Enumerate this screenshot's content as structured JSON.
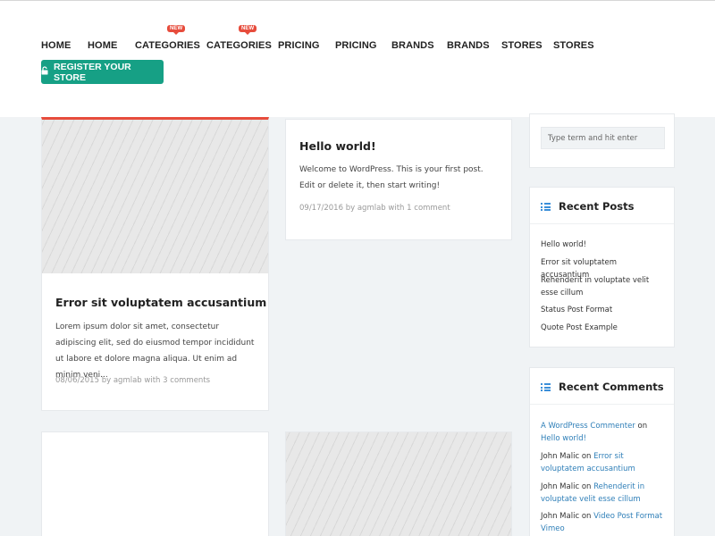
{
  "nav": {
    "items": [
      {
        "label": "HOME",
        "badge": ""
      },
      {
        "label": "HOME",
        "badge": ""
      },
      {
        "label": "CATEGORIES",
        "badge": "NEW"
      },
      {
        "label": "CATEGORIES",
        "badge": "NEW"
      },
      {
        "label": "PRICING",
        "badge": ""
      },
      {
        "label": "PRICING",
        "badge": ""
      },
      {
        "label": "BRANDS",
        "badge": ""
      },
      {
        "label": "BRANDS",
        "badge": ""
      },
      {
        "label": "STORES",
        "badge": ""
      },
      {
        "label": "STORES",
        "badge": ""
      }
    ],
    "register_label": "REGISTER YOUR STORE"
  },
  "posts": [
    {
      "title": "Hello world!",
      "excerpt": "Welcome to WordPress. This is your first post. Edit or delete it, then start writing!",
      "date": "09/17/2016",
      "by": "by",
      "author": "agmlab",
      "with": "with",
      "comments": "1 comment"
    },
    {
      "title": "Error sit voluptatem accusantium",
      "excerpt": "Lorem ipsum dolor sit amet, consectetur adipiscing elit, sed do eiusmod tempor incididunt ut labore et dolore magna aliqua. Ut enim ad minim veni...",
      "date": "08/06/2015",
      "by": "by",
      "author": "agmlab",
      "with": "with",
      "comments": "3 comments"
    }
  ],
  "sidebar": {
    "search_placeholder": "Type term and hit enter",
    "recent_posts": {
      "title": "Recent Posts",
      "items": [
        "Hello world!",
        "Error sit voluptatem accusantium",
        "Rehenderit in voluptate velit esse cillum",
        "Status Post Format",
        "Quote Post Example"
      ]
    },
    "recent_comments": {
      "title": "Recent Comments",
      "on_word": "on",
      "items": [
        {
          "author": "A WordPress Commenter",
          "post": "Hello world!"
        },
        {
          "author": "John Malic",
          "post": "Error sit voluptatem accusantium"
        },
        {
          "author": "John Malic",
          "post": "Rehenderit in voluptate velit esse cillum"
        },
        {
          "author": "John Malic",
          "post": "Video Post Format Vimeo"
        }
      ]
    }
  },
  "colors": {
    "accent_green": "#16a085",
    "badge_red": "#e74c3c",
    "link_blue": "#2f7fb8",
    "active_card_border": "#e74c3c"
  }
}
